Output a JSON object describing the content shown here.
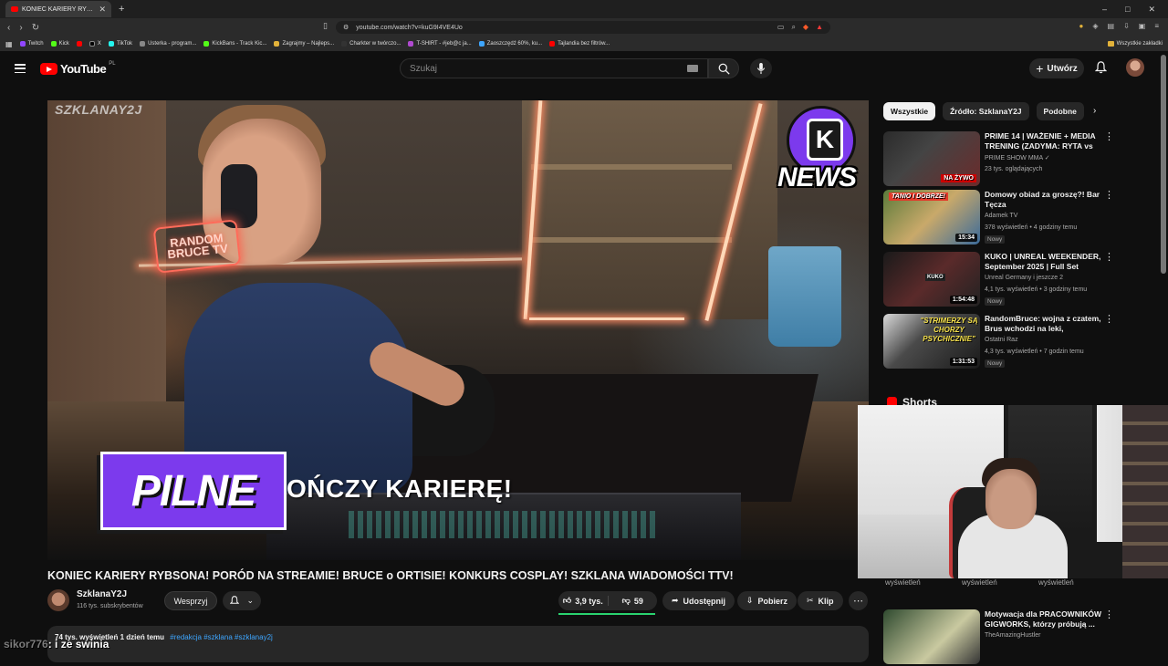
{
  "browser": {
    "tab_title": "KONIEC KARIERY RYBSONA!",
    "url": "youtube.com/watch?v=kuG9I4VE4Uo",
    "new_tab": "+",
    "window_controls": [
      "–",
      "□",
      "✕"
    ]
  },
  "bookmarks": {
    "items": [
      "Twitch",
      "Kick",
      "X",
      "TikTok",
      "Usterka - program...",
      "KickBans - Track Kic...",
      "Zagrajmy – Najleps...",
      "Charkter w twórczo...",
      "T-SHIRT - #jeb@c ja...",
      "Zaoszczędź 60%, ku...",
      "Tajlandia bez filtrów..."
    ],
    "all_label": "Wszystkie zakładki"
  },
  "youtube": {
    "logo_text": "YouTube",
    "country_code": "PL",
    "search_placeholder": "Szukaj",
    "create_label": "Utwórz"
  },
  "player": {
    "watermark": "SZKLANAY2J",
    "news_word": "NEWS",
    "news_k": "K",
    "neon_line1": "RANDOM",
    "neon_line2": "BRUCE TV",
    "lower_third": "PILNE",
    "headline": "OŃCZY KARIERĘ!"
  },
  "video": {
    "title": "KONIEC KARIERY RYBSONA! PORÓD NA STREAMIE! BRUCE o ORTISIE! KONKURS COSPLAY! SZKLANA WIADOMOŚCI TTV!",
    "channel_name": "SzklanaY2J",
    "channel_subs": "116 tys. subskrybentów",
    "support_label": "Wesprzyj",
    "likes": "3,9 tys.",
    "dislikes": "59",
    "share_label": "Udostępnij",
    "download_label": "Pobierz",
    "clip_label": "Klip",
    "description_meta": "74 tys. wyświetleń  1 dzień temu",
    "description_tags": "#redakcja #szklana #szklanay2j"
  },
  "sidebar": {
    "chips": [
      "Wszystkie",
      "Źródło: SzklanaY2J",
      "Podobne"
    ],
    "recommendations": [
      {
        "title": "PRIME 14 | WAŻENIE + MEDIA TRENING (ZADYMA: RYTA vs ...",
        "channel": "PRIME SHOW MMA ✓",
        "meta": "23 tys. oglądających",
        "duration": "",
        "badge": "",
        "thumb_text": "NA ŻYWO"
      },
      {
        "title": "Domowy obiad za groszę?! Bar Tęcza",
        "channel": "Adamek TV",
        "meta": "378 wyświetleń • 4 godziny temu",
        "duration": "15:34",
        "badge": "Nowy",
        "thumb_text": "TANIO I DOBRZE!"
      },
      {
        "title": "KUKO | UNREAL WEEKENDER, September 2025 | Full Set",
        "channel": "Unreal Germany i jeszcze 2",
        "meta": "4,1 tys. wyświetleń • 3 godziny temu",
        "duration": "1:54:48",
        "badge": "Nowy",
        "thumb_text": "KUKO"
      },
      {
        "title": "RandomBruce: wojna z czatem, Brus wchodzi na leki, mądrość...",
        "channel": "Ostatni Raz",
        "meta": "4,3 tys. wyświetleń • 7 godzin temu",
        "duration": "1:31:53",
        "badge": "Nowy",
        "thumb_text": "\"STRIMERZY SĄ CHORZY PSYCHICZNIE\""
      },
      {
        "title": "Motywacja dla PRACOWNIKÓW GIGWORKS, którzy próbują ...",
        "channel": "TheAmazingHustler",
        "meta": "",
        "duration": "",
        "badge": "",
        "thumb_text": ""
      }
    ],
    "shorts_label": "Shorts",
    "shorts_views": [
      "wyświetleń",
      "wyświetleń",
      "wyświetleń"
    ]
  },
  "chat": {
    "user": "sikor776",
    "message": ": i ze swinia"
  }
}
